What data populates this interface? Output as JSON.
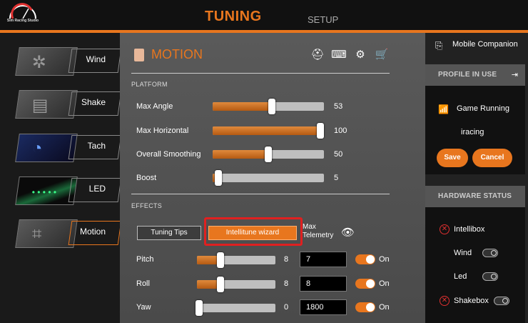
{
  "header": {
    "logo_text": "Sim Racing Studio",
    "tabs": [
      {
        "label": "TUNING",
        "active": true
      },
      {
        "label": "SETUP",
        "active": false
      }
    ],
    "accent_color": "#e8761e"
  },
  "sidebar": {
    "items": [
      {
        "label": "Wind",
        "icon": "fan-icon"
      },
      {
        "label": "Shake",
        "icon": "shaker-icon"
      },
      {
        "label": "Tach",
        "icon": "tachometer-icon"
      },
      {
        "label": "LED",
        "icon": "led-strip-icon"
      },
      {
        "label": "Motion",
        "icon": "motion-rig-icon",
        "active": true
      }
    ]
  },
  "main": {
    "title": "MOTION",
    "toolbar_icons": [
      "helmet-icon",
      "keyboard-icon",
      "gear-icon",
      "cart-icon"
    ],
    "platform": {
      "section_label": "PLATFORM",
      "sliders": [
        {
          "label": "Max Angle",
          "value": 53,
          "fill_fraction": 0.53
        },
        {
          "label": "Max Horizontal",
          "value": 100,
          "fill_fraction": 1.0
        },
        {
          "label": "Overall Smoothing",
          "value": 50,
          "fill_fraction": 0.5
        },
        {
          "label": "Boost",
          "value": 5,
          "fill_fraction": 0.05
        }
      ]
    },
    "effects": {
      "section_label": "EFFECTS",
      "tuning_tips_label": "Tuning Tips",
      "wizard_label": "Intellitune wizard",
      "max_telemetry_label": "Max Telemetry",
      "rows": [
        {
          "label": "Pitch",
          "slider_value": 8,
          "fill_fraction": 0.3,
          "input_value": "7",
          "toggle_label": "On"
        },
        {
          "label": "Roll",
          "slider_value": 8,
          "fill_fraction": 0.3,
          "input_value": "8",
          "toggle_label": "On"
        },
        {
          "label": "Yaw",
          "slider_value": 0,
          "fill_fraction": 0.0,
          "input_value": "1800",
          "toggle_label": "On"
        }
      ]
    }
  },
  "right_panel": {
    "mobile_companion_label": "Mobile Companion",
    "profile_header": "PROFILE IN USE",
    "status_text": "Game Running",
    "game_name": "iracing",
    "save_label": "Save",
    "cancel_label": "Cancel",
    "hardware_header": "HARDWARE STATUS",
    "hardware": [
      {
        "label": "Intellibox",
        "error": true
      },
      {
        "label": "Wind",
        "toggle": true
      },
      {
        "label": "Led",
        "toggle": true
      },
      {
        "label": "Shakebox",
        "error": true,
        "toggle": true
      }
    ]
  }
}
